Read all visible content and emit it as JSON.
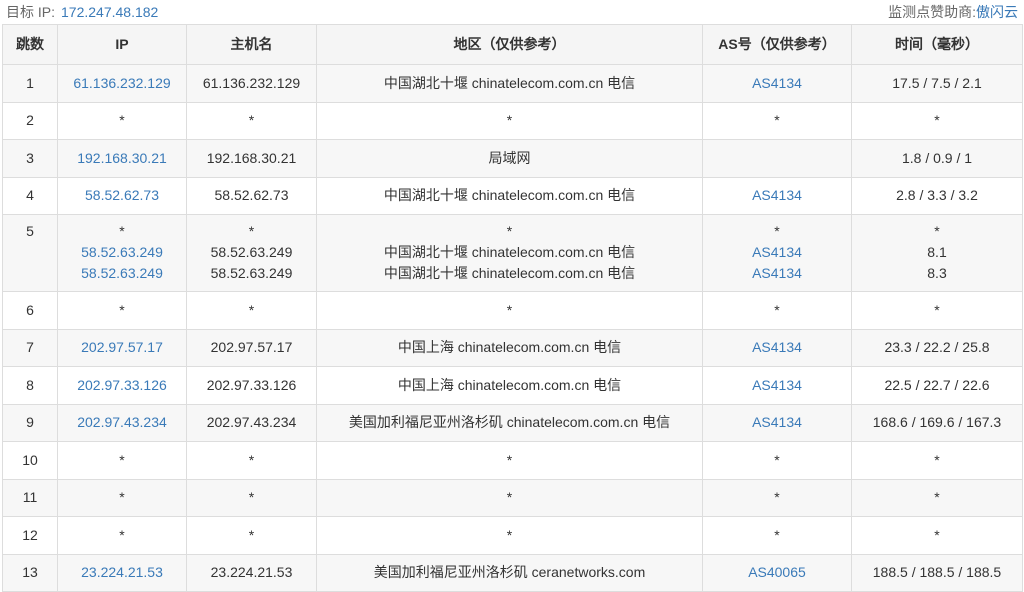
{
  "header": {
    "target_label": "目标 IP:",
    "target_ip": "172.247.48.182",
    "sponsor_label": "监测点赞助商:",
    "sponsor_name": "傲闪云"
  },
  "columns": [
    "跳数",
    "IP",
    "主机名",
    "地区（仅供参考）",
    "AS号（仅供参考）",
    "时间（毫秒）"
  ],
  "rows": [
    {
      "hop": "1",
      "ip": [
        "61.136.232.129"
      ],
      "host": [
        "61.136.232.129"
      ],
      "region": [
        "中国湖北十堰 chinatelecom.com.cn 电信"
      ],
      "as": [
        "AS4134"
      ],
      "time": [
        "17.5 / 7.5 / 2.1"
      ]
    },
    {
      "hop": "2",
      "ip": [
        "*"
      ],
      "host": [
        "*"
      ],
      "region": [
        "*"
      ],
      "as": [
        "*"
      ],
      "time": [
        "*"
      ]
    },
    {
      "hop": "3",
      "ip": [
        "192.168.30.21"
      ],
      "host": [
        "192.168.30.21"
      ],
      "region": [
        "局域网"
      ],
      "as": [
        ""
      ],
      "time": [
        "1.8 / 0.9 / 1"
      ]
    },
    {
      "hop": "4",
      "ip": [
        "58.52.62.73"
      ],
      "host": [
        "58.52.62.73"
      ],
      "region": [
        "中国湖北十堰 chinatelecom.com.cn 电信"
      ],
      "as": [
        "AS4134"
      ],
      "time": [
        "2.8 / 3.3 / 3.2"
      ]
    },
    {
      "hop": "5",
      "ip": [
        "*",
        "58.52.63.249",
        "58.52.63.249"
      ],
      "host": [
        "*",
        "58.52.63.249",
        "58.52.63.249"
      ],
      "region": [
        "*",
        "中国湖北十堰 chinatelecom.com.cn 电信",
        "中国湖北十堰 chinatelecom.com.cn 电信"
      ],
      "as": [
        "*",
        "AS4134",
        "AS4134"
      ],
      "time": [
        "*",
        "8.1",
        "8.3"
      ]
    },
    {
      "hop": "6",
      "ip": [
        "*"
      ],
      "host": [
        "*"
      ],
      "region": [
        "*"
      ],
      "as": [
        "*"
      ],
      "time": [
        "*"
      ]
    },
    {
      "hop": "7",
      "ip": [
        "202.97.57.17"
      ],
      "host": [
        "202.97.57.17"
      ],
      "region": [
        "中国上海 chinatelecom.com.cn 电信"
      ],
      "as": [
        "AS4134"
      ],
      "time": [
        "23.3 / 22.2 / 25.8"
      ]
    },
    {
      "hop": "8",
      "ip": [
        "202.97.33.126"
      ],
      "host": [
        "202.97.33.126"
      ],
      "region": [
        "中国上海 chinatelecom.com.cn 电信"
      ],
      "as": [
        "AS4134"
      ],
      "time": [
        "22.5 / 22.7 / 22.6"
      ]
    },
    {
      "hop": "9",
      "ip": [
        "202.97.43.234"
      ],
      "host": [
        "202.97.43.234"
      ],
      "region": [
        "美国加利福尼亚州洛杉矶 chinatelecom.com.cn 电信"
      ],
      "as": [
        "AS4134"
      ],
      "time": [
        "168.6 / 169.6 / 167.3"
      ]
    },
    {
      "hop": "10",
      "ip": [
        "*"
      ],
      "host": [
        "*"
      ],
      "region": [
        "*"
      ],
      "as": [
        "*"
      ],
      "time": [
        "*"
      ]
    },
    {
      "hop": "11",
      "ip": [
        "*"
      ],
      "host": [
        "*"
      ],
      "region": [
        "*"
      ],
      "as": [
        "*"
      ],
      "time": [
        "*"
      ]
    },
    {
      "hop": "12",
      "ip": [
        "*"
      ],
      "host": [
        "*"
      ],
      "region": [
        "*"
      ],
      "as": [
        "*"
      ],
      "time": [
        "*"
      ]
    },
    {
      "hop": "13",
      "ip": [
        "23.224.21.53"
      ],
      "host": [
        "23.224.21.53"
      ],
      "region": [
        "美国加利福尼亚州洛杉矶 ceranetworks.com"
      ],
      "as": [
        "AS40065"
      ],
      "time": [
        "188.5 / 188.5 / 188.5"
      ]
    }
  ],
  "colors": {
    "link": "#3a7ab8",
    "header_bg": "#f5f5f5",
    "row_alt": "#f7f7f7",
    "border": "#dddddd"
  }
}
